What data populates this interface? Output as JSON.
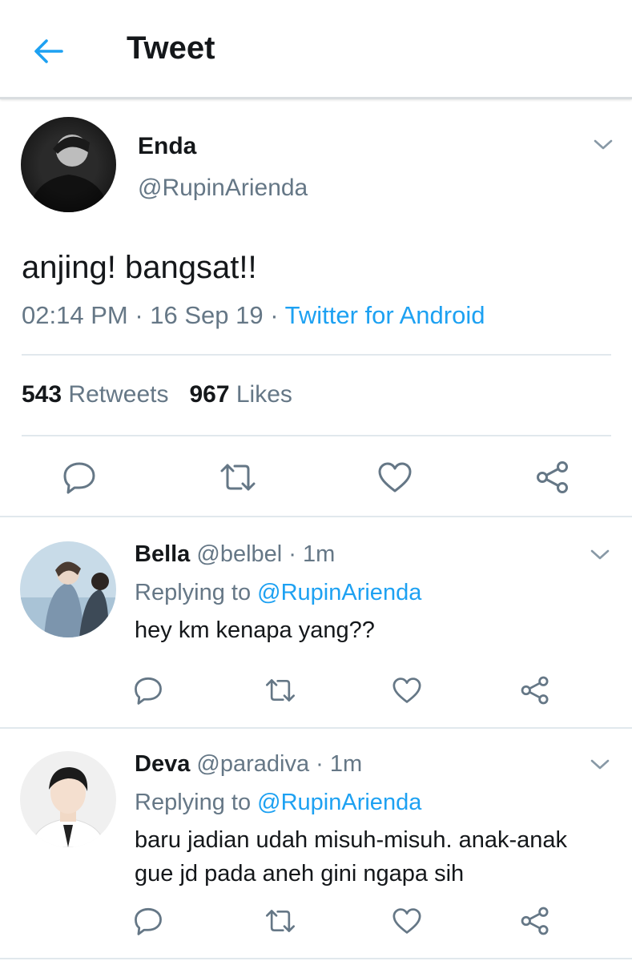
{
  "header": {
    "title": "Tweet"
  },
  "tweet": {
    "author_name": "Enda",
    "author_handle": "@RupinArienda",
    "text": "anjing! bangsat!!",
    "time": "02:14 PM",
    "date": "16 Sep 19",
    "source": "Twitter for Android",
    "retweet_count": "543",
    "retweet_label": "Retweets",
    "like_count": "967",
    "like_label": "Likes"
  },
  "replies": [
    {
      "name": "Bella",
      "handle": "@belbel",
      "time": "1m",
      "replying_prefix": "Replying to",
      "replying_to": "@RupinArienda",
      "text": "hey km kenapa yang??"
    },
    {
      "name": "Deva",
      "handle": "@paradiva",
      "time": "1m",
      "replying_prefix": "Replying to",
      "replying_to": "@RupinArienda",
      "text": "baru jadian udah misuh-misuh. anak-anak gue jd pada aneh gini ngapa sih"
    }
  ],
  "colors": {
    "accent": "#1da1f2",
    "text": "#14171a",
    "muted": "#657786",
    "divider": "#e1e8ed"
  },
  "icons": [
    "back-arrow-icon",
    "chevron-down-icon",
    "reply-icon",
    "retweet-icon",
    "like-icon",
    "share-icon"
  ]
}
